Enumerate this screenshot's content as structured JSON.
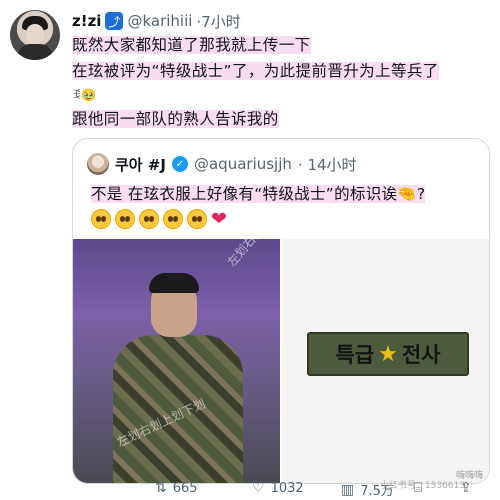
{
  "tweet": {
    "display_name": "z!zi",
    "handle": "@karihiii",
    "time": "·7小时",
    "lines": [
      "既然大家都知道了那我就上传一下",
      "在玹被评为“特级战士”了，为此提前晋升为上等兵了",
      "跟他同一部队的熟人告诉我的"
    ],
    "emoji_text": "ꉂ🥹"
  },
  "quote": {
    "display_name": "쿠아 #J",
    "handle": "@aquariusjjh",
    "time": "· 14小时",
    "text": "不是 在玹衣服上好像有“特级战士”的标识诶🤏?",
    "emoji_count": 5,
    "media": {
      "watermark_top": "左划右划上划下划",
      "watermark_bottom": "左划右划上划下划",
      "patch_left": "특급",
      "patch_right": "전사",
      "corner_tag": "嗨嗨嗨"
    }
  },
  "actions": {
    "retweets": "665",
    "likes": "1032",
    "views": "7.5万"
  },
  "footer_tag": "小红书号：1536613",
  "colors": {
    "highlight": "#fadcf0",
    "verified": "#1d9bf0",
    "muted": "#536471"
  }
}
